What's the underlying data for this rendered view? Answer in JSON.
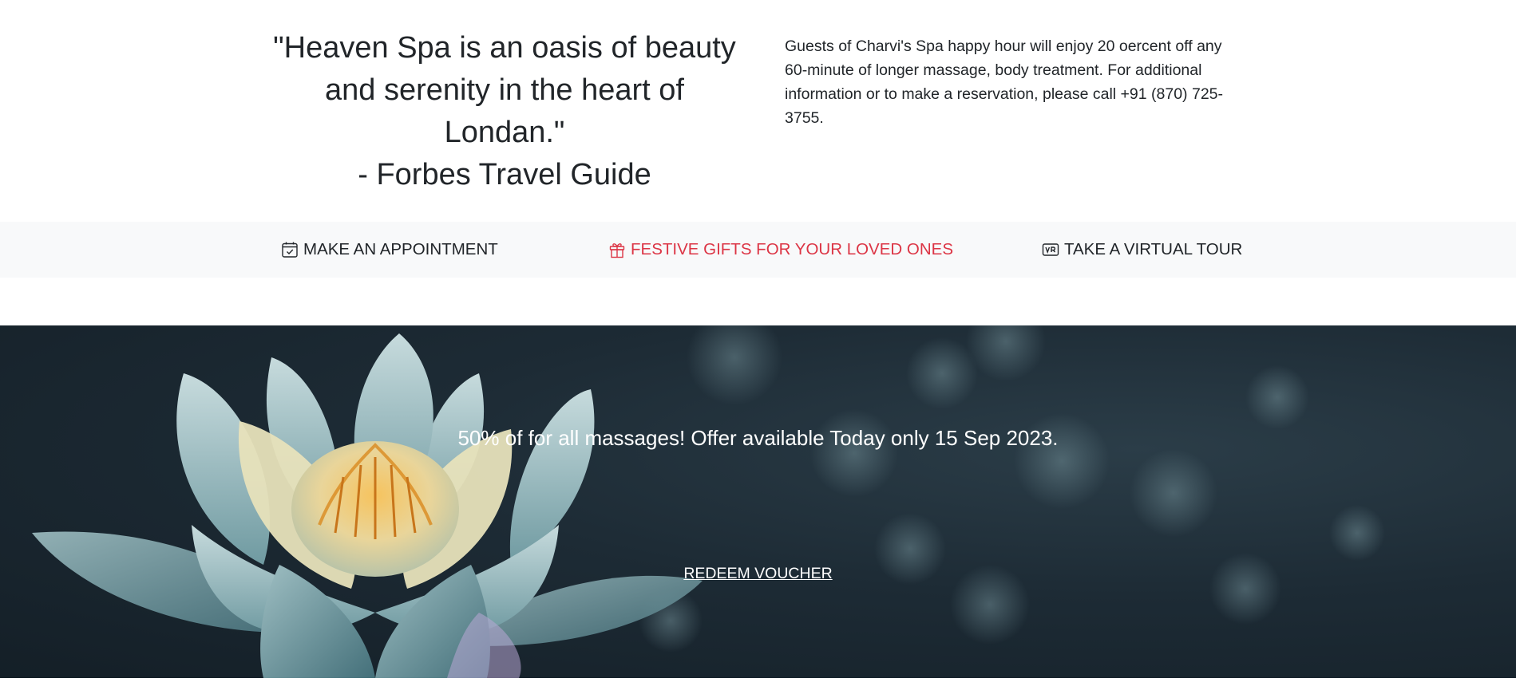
{
  "intro": {
    "quote_lines": [
      "\"Heaven Spa is an oasis of beauty",
      "and serenity in the heart of Londan.\"",
      "- Forbes Travel Guide"
    ],
    "info_text": "Guests of Charvi's Spa happy hour will enjoy 20 oercent off any 60-minute of longer massage, body treatment. For additional information or to make a reservation, please call +91 (870) 725-3755."
  },
  "quick_links": [
    {
      "label": "MAKE AN APPOINTMENT",
      "icon": "calendar-check-icon"
    },
    {
      "label": "FESTIVE GIFTS FOR YOUR LOVED ONES",
      "icon": "gift-icon",
      "color": "#dc3545"
    },
    {
      "label": "TAKE A VIRTUAL TOUR",
      "icon": "vr-icon"
    }
  ],
  "promo": {
    "text": "50% of for all massages! Offer available Today only 15 Sep 2023.",
    "cta_label": "REDEEM VOUCHER"
  },
  "colors": {
    "text": "#212529",
    "accent_red": "#dc3545",
    "bar_bg": "#f8f9fa",
    "banner_bg": "#1d2b35"
  }
}
